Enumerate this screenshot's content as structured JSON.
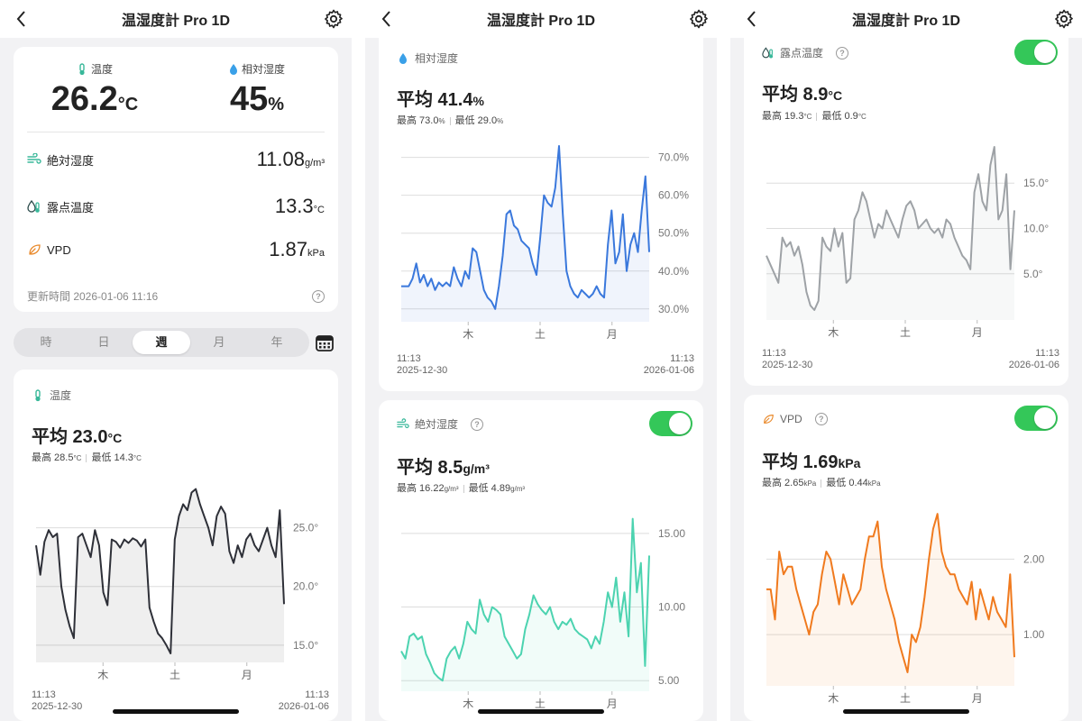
{
  "app": {
    "title": "温湿度計 Pro 1D"
  },
  "summary": {
    "temp_label": "温度",
    "temp_value": "26.2",
    "temp_unit": "°C",
    "hum_label": "相対湿度",
    "hum_value": "45",
    "hum_unit": "%",
    "rows": [
      {
        "label": "絶対湿度",
        "value": "11.08",
        "unit": "g/m³",
        "icon": "absolute-humidity-icon"
      },
      {
        "label": "露点温度",
        "value": "13.3",
        "unit": "°C",
        "icon": "dew-point-icon"
      },
      {
        "label": "VPD",
        "value": "1.87",
        "unit": "kPa",
        "icon": "leaf-icon"
      }
    ],
    "updated": "更新時間 2026-01-06 11:16"
  },
  "tabs": {
    "items": [
      "時",
      "日",
      "週",
      "月",
      "年"
    ],
    "active": "週"
  },
  "range": {
    "start_time": "11:13",
    "start_date": "2025-12-30",
    "end_time": "11:13",
    "end_date": "2026-01-06"
  },
  "cards": {
    "temp": {
      "title": "温度",
      "avg": "平均 23.0",
      "unit": "°C",
      "max_label": "最高 28.5",
      "max_unit": "°C",
      "min_label": "最低 14.3",
      "min_unit": "°C"
    },
    "hum": {
      "title": "相対湿度",
      "avg": "平均 41.4",
      "unit": "%",
      "max_label": "最高 73.0",
      "max_unit": "%",
      "min_label": "最低 29.0",
      "min_unit": "%"
    },
    "abs": {
      "title": "絶対湿度",
      "avg": "平均 8.5",
      "unit": "g/m³",
      "max_label": "最高 16.22",
      "max_unit": "g/m³",
      "min_label": "最低 4.89",
      "min_unit": "g/m³"
    },
    "dew": {
      "title": "露点温度",
      "avg": "平均 8.9",
      "unit": "°C",
      "max_label": "最高 19.3",
      "max_unit": "°C",
      "min_label": "最低 0.9",
      "min_unit": "°C"
    },
    "vpd": {
      "title": "VPD",
      "avg": "平均 1.69",
      "unit": "kPa",
      "max_label": "最高 2.65",
      "max_unit": "kPa",
      "min_label": "最低 0.44",
      "min_unit": "kPa"
    }
  },
  "colors": {
    "temp": "#2e3038",
    "hum": "#3a78dc",
    "abs": "#4cd3b0",
    "dew": "#9ea2a6",
    "vpd": "#f07a1e",
    "toggle": "#34c759"
  },
  "chart_data": [
    {
      "id": "temp",
      "type": "line",
      "x_ticks": [
        "木",
        "土",
        "月"
      ],
      "y_ticks": [
        "25.0°",
        "20.0°",
        "15.0°"
      ],
      "ylim": [
        14.3,
        28.5
      ],
      "points": [
        23.5,
        21,
        23.8,
        24.8,
        24.2,
        24.5,
        20,
        18,
        16.6,
        15.6,
        24.2,
        24.5,
        23.5,
        22.5,
        24.8,
        23.5,
        19.5,
        18.4,
        24.0,
        23.8,
        23.3,
        24.0,
        23.7,
        24.1,
        23.9,
        23.4,
        24.0,
        18.2,
        17,
        16,
        15.6,
        15.0,
        14.3,
        24,
        26,
        27,
        26.5,
        28,
        28.3,
        27,
        26,
        25,
        23.5,
        26,
        26.8,
        26.2,
        23,
        22,
        23.5,
        22.5,
        24,
        24.5,
        23.5,
        23,
        24,
        25,
        23.5,
        22.5,
        26.5,
        18.5
      ]
    },
    {
      "id": "hum",
      "type": "line",
      "x_ticks": [
        "木",
        "土",
        "月"
      ],
      "y_ticks": [
        "70.0%",
        "60.0%",
        "50.0%",
        "40.0%",
        "30.0%"
      ],
      "ylim": [
        29,
        73
      ],
      "points": [
        36,
        36,
        36,
        38,
        42,
        37,
        39,
        36,
        38,
        35,
        37,
        36,
        37,
        36,
        41,
        38,
        36,
        40,
        38,
        46,
        45,
        40,
        35,
        33,
        32,
        30,
        36,
        44,
        55,
        56,
        52,
        51,
        48,
        47,
        46,
        42,
        39,
        49,
        60,
        58,
        57,
        62,
        73,
        55,
        40,
        36,
        34,
        33,
        35,
        34,
        33,
        34,
        36,
        34,
        33,
        47,
        56,
        42,
        45,
        55,
        40,
        47,
        50,
        45,
        56,
        65,
        45
      ]
    },
    {
      "id": "abs",
      "type": "line",
      "x_ticks": [
        "木",
        "土",
        "月"
      ],
      "y_ticks": [
        "15.00",
        "10.00",
        "5.00"
      ],
      "ylim": [
        4.89,
        16.22
      ],
      "points": [
        7,
        6.5,
        8,
        8.2,
        7.8,
        8,
        6.8,
        6.2,
        5.5,
        5.2,
        5,
        6.5,
        7,
        7.3,
        6.5,
        7.5,
        9,
        8.5,
        8.2,
        10.5,
        9.5,
        9,
        10,
        9.8,
        9.5,
        8,
        7.5,
        7,
        6.5,
        6.8,
        8.5,
        9.5,
        10.8,
        10.2,
        9.8,
        9.5,
        10,
        9,
        8.5,
        9,
        8.8,
        9.2,
        8.5,
        8.2,
        8,
        7.8,
        7.2,
        8,
        7.5,
        9,
        11,
        10,
        12,
        9,
        11,
        8,
        16,
        11,
        13,
        6,
        13.5
      ]
    },
    {
      "id": "dew",
      "type": "line",
      "x_ticks": [
        "木",
        "土",
        "月"
      ],
      "y_ticks": [
        "15.0°",
        "10.0°",
        "5.0°"
      ],
      "ylim": [
        0.9,
        19.3
      ],
      "points": [
        7,
        6,
        5,
        4,
        9,
        8,
        8.5,
        7,
        8,
        6,
        3,
        1.5,
        1,
        2,
        9,
        8,
        7.5,
        10,
        8,
        9.5,
        4,
        4.5,
        11,
        12,
        14,
        13,
        11,
        9,
        10.5,
        10,
        12,
        11,
        10,
        9,
        11,
        12.5,
        13,
        12,
        10,
        10.5,
        11,
        10,
        9.5,
        10,
        9,
        11,
        10.5,
        9,
        8,
        7,
        6.5,
        5.5,
        14,
        16,
        13,
        12,
        17,
        19,
        11,
        12,
        16,
        5.5,
        12
      ]
    },
    {
      "id": "vpd",
      "type": "line",
      "x_ticks": [
        "木",
        "土",
        "月"
      ],
      "y_ticks": [
        "2.00",
        "1.00"
      ],
      "ylim": [
        0.44,
        2.65
      ],
      "points": [
        1.6,
        1.6,
        1.2,
        2.1,
        1.8,
        1.9,
        1.9,
        1.6,
        1.4,
        1.2,
        1.0,
        1.3,
        1.4,
        1.8,
        2.1,
        2.0,
        1.7,
        1.4,
        1.8,
        1.6,
        1.4,
        1.5,
        1.6,
        2.0,
        2.3,
        2.3,
        2.5,
        1.9,
        1.6,
        1.4,
        1.2,
        0.9,
        0.7,
        0.5,
        1.0,
        0.9,
        1.1,
        1.5,
        2.0,
        2.4,
        2.6,
        2.1,
        1.9,
        1.8,
        1.8,
        1.6,
        1.5,
        1.4,
        1.7,
        1.2,
        1.6,
        1.4,
        1.2,
        1.5,
        1.3,
        1.2,
        1.1,
        1.8,
        0.7
      ]
    }
  ]
}
